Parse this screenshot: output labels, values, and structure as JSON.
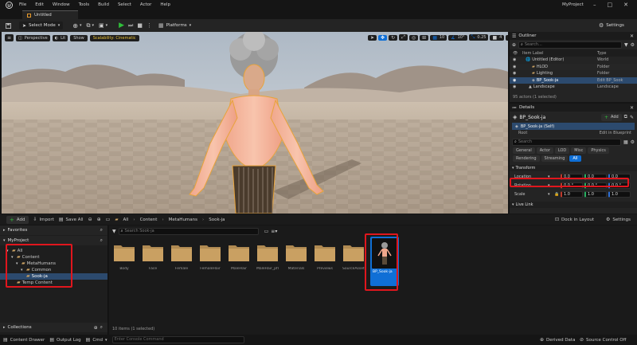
{
  "menubar": {
    "items": [
      "File",
      "Edit",
      "Window",
      "Tools",
      "Build",
      "Select",
      "Actor",
      "Help"
    ],
    "project_name": "MyProject"
  },
  "tab": {
    "label": "Untitled"
  },
  "toolbar": {
    "select_mode": "Select Mode",
    "platforms": "Platforms",
    "settings": "Settings"
  },
  "viewport": {
    "perspective": "Perspective",
    "lit": "Lit",
    "show": "Show",
    "scalability": "Scalability: Cinematic",
    "grid_snap": "10",
    "rot_snap": "10°",
    "scale_snap": "0.25",
    "camera_speed": "4"
  },
  "outliner": {
    "title": "Outliner",
    "search_placeholder": "Search...",
    "col_label": "Item Label",
    "col_type": "Type",
    "rows": [
      {
        "label": "Untitled (Editor)",
        "type": "World"
      },
      {
        "label": "HLOD",
        "type": "Folder"
      },
      {
        "label": "Lighting",
        "type": "Folder"
      },
      {
        "label": "BP_Sook-ja",
        "type": "Edit BP_Sook"
      },
      {
        "label": "Landscape",
        "type": "Landscape"
      }
    ],
    "status": "95 actors (1 selected)"
  },
  "details": {
    "title": "Details",
    "actor_name": "BP_Sook-ja",
    "add_label": "Add",
    "component_self": "BP_Sook-ja (Self)",
    "component_root": "Root",
    "component_root_note": "Edit in Blueprint",
    "search_placeholder": "Search",
    "filter_row1": [
      "General",
      "Actor",
      "LOD",
      "Misc",
      "Physics"
    ],
    "filter_row2": [
      "Rendering",
      "Streaming",
      "All"
    ],
    "section_transform": "Transform",
    "location_label": "Location",
    "location": [
      "0.0",
      "0.0",
      "0.0"
    ],
    "rotation_label": "Rotation",
    "rotation": [
      "0.0 °",
      "0.0 °",
      "0.0 °"
    ],
    "scale_label": "Scale",
    "scale": [
      "1.0",
      "1.0",
      "1.0"
    ],
    "section_livelink": "Live Link"
  },
  "content_browser": {
    "add": "Add",
    "import": "Import",
    "save_all": "Save All",
    "breadcrumb": [
      "All",
      "Content",
      "MetaHumans",
      "Sook-ja"
    ],
    "dock": "Dock in Layout",
    "settings": "Settings",
    "search_placeholder": "Search Sook-ja",
    "favorites": "Favorites",
    "project": "MyProject",
    "tree": [
      "All",
      "Content",
      "MetaHumans",
      "Common",
      "Sook-ja",
      "Temp Content"
    ],
    "collections": "Collections",
    "folders": [
      "Body",
      "Face",
      "Female",
      "FemaleHair",
      "MaleHair",
      "MaleHair_pfm",
      "Materials",
      "Previews",
      "SourceAssets"
    ],
    "selected_asset": "BP_Sook-ja",
    "status": "10 items (1 selected)"
  },
  "statusbar": {
    "content_drawer": "Content Drawer",
    "output_log": "Output Log",
    "cmd": "Cmd",
    "console_placeholder": "Enter Console Command",
    "derived_data": "Derived Data",
    "source_control": "Source Control Off"
  },
  "colors": {
    "accent_blue": "#0f6fd6",
    "selection_red": "#e0161d",
    "play_green": "#2fbf3a",
    "folder": "#c9a062"
  }
}
